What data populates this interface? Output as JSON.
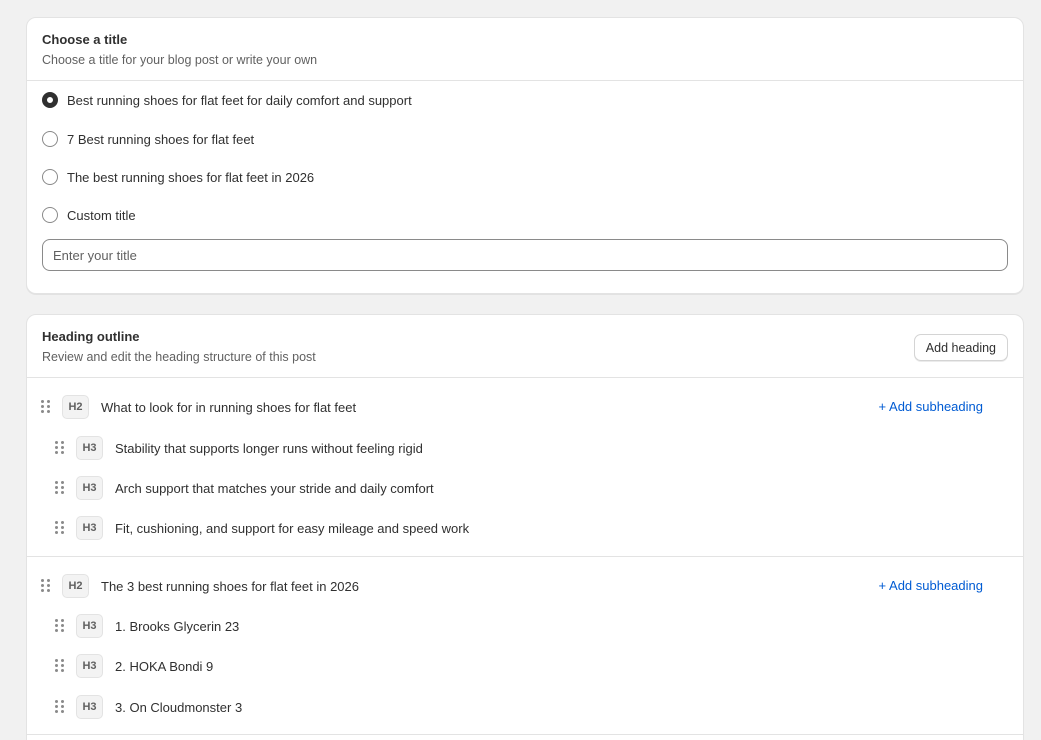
{
  "title_card": {
    "title": "Choose a title",
    "subtitle": "Choose a title for your blog post or write your own",
    "options": [
      {
        "label": "Best running shoes for flat feet for daily comfort and support",
        "selected": true
      },
      {
        "label": "7 Best running shoes for flat feet",
        "selected": false
      },
      {
        "label": "The best running shoes for flat feet in 2026",
        "selected": false
      },
      {
        "label": "Custom title",
        "selected": false
      }
    ],
    "custom_input": {
      "value": "",
      "placeholder": "Enter your title"
    }
  },
  "outline_card": {
    "title": "Heading outline",
    "subtitle": "Review and edit the heading structure of this post",
    "add_heading_label": "Add heading",
    "add_subheading_label": "+ Add subheading",
    "sections": [
      {
        "level": "H2",
        "text": "What to look for in running shoes for flat feet",
        "children": [
          {
            "level": "H3",
            "text": "Stability that supports longer runs without feeling rigid"
          },
          {
            "level": "H3",
            "text": "Arch support that matches your stride and daily comfort"
          },
          {
            "level": "H3",
            "text": "Fit, cushioning, and support for easy mileage and speed work"
          }
        ]
      },
      {
        "level": "H2",
        "text": "The 3 best running shoes for flat feet in 2026",
        "children": [
          {
            "level": "H3",
            "text": "1. Brooks Glycerin 23"
          },
          {
            "level": "H3",
            "text": "2. HOKA Bondi 9"
          },
          {
            "level": "H3",
            "text": "3. On Cloudmonster 3"
          }
        ]
      }
    ]
  },
  "colors": {
    "background": "#f1f1f1",
    "card": "#ffffff",
    "border": "#e3e3e3",
    "text": "#303030",
    "muted": "#616161",
    "link": "#005bd3"
  },
  "icons": {
    "drag": "drag-handle-icon"
  }
}
